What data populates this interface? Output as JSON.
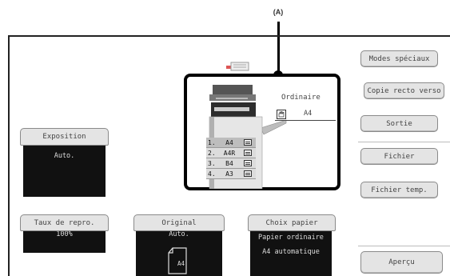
{
  "callout": {
    "label": "(A)"
  },
  "preview": {
    "paper_type": "Ordinaire",
    "paper_size": "A4",
    "trays": [
      {
        "num": "1.",
        "size": "A4"
      },
      {
        "num": "2.",
        "size": "A4R"
      },
      {
        "num": "3.",
        "size": "B4"
      },
      {
        "num": "4.",
        "size": "A3"
      }
    ]
  },
  "right_buttons": {
    "special_modes": "Modes spéciaux",
    "duplex_copy": "Copie recto verso",
    "output": "Sortie",
    "file": "Fichier",
    "temp_file": "Fichier temp.",
    "preview": "Aperçu"
  },
  "exposure": {
    "label": "Exposition",
    "value": "Auto."
  },
  "ratio": {
    "label": "Taux de repro.",
    "value": "100%"
  },
  "original": {
    "label": "Original",
    "value": "Auto.",
    "size": "A4"
  },
  "paper_select": {
    "label": "Choix papier",
    "line1": "Papier ordinaire",
    "line2": "A4 automatique"
  }
}
